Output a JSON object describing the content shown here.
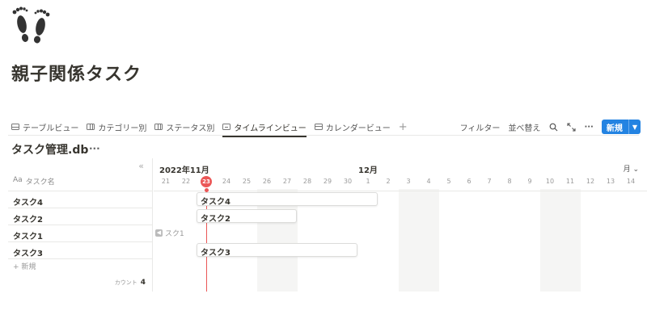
{
  "page": {
    "title": "親子関係タスク",
    "icon": "footprints-icon"
  },
  "views": {
    "tabs": [
      {
        "label": "テーブルビュー",
        "icon": "table-icon"
      },
      {
        "label": "カテゴリー別",
        "icon": "board-icon"
      },
      {
        "label": "ステータス別",
        "icon": "board-icon"
      },
      {
        "label": "タイムラインビュー",
        "icon": "timeline-icon",
        "active": true
      },
      {
        "label": "カレンダービュー",
        "icon": "calendar-icon"
      }
    ],
    "add": "+"
  },
  "actions": {
    "filter": "フィルター",
    "sort": "並べ替え",
    "new_label": "新規"
  },
  "database": {
    "title": "タスク管理.db",
    "more": "···"
  },
  "table": {
    "collapse": "«",
    "column_icon": "Aa",
    "column_name": "タスク名",
    "rows": [
      "タスク4",
      "タスク2",
      "タスク1",
      "タスク3"
    ],
    "new_row": "+ 新規",
    "count_label": "カウント",
    "count_value": "4"
  },
  "timeline": {
    "month_a": "2022年11月",
    "month_b": "12月",
    "scale": "月 ⌄",
    "days": [
      "21",
      "22",
      "23",
      "24",
      "25",
      "26",
      "27",
      "28",
      "29",
      "30",
      "1",
      "2",
      "3",
      "4",
      "5",
      "6",
      "7",
      "8",
      "9",
      "10",
      "11",
      "12",
      "13",
      "14"
    ],
    "today": "23",
    "weekend_days": [
      "26",
      "27",
      "3",
      "4",
      "10",
      "11"
    ],
    "bars": [
      {
        "label": "タスク4",
        "row": 0,
        "start_day": "23",
        "end_day": "1"
      },
      {
        "label": "タスク2",
        "row": 1,
        "start_day": "23",
        "end_day": "27"
      },
      {
        "label": "タスク3",
        "row": 3,
        "start_day": "23",
        "end_day": "30"
      }
    ],
    "offscreen_label": "スク1"
  }
}
